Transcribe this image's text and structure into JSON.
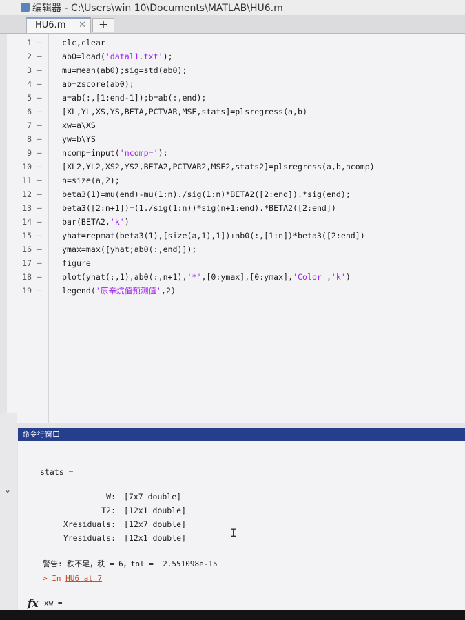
{
  "window": {
    "title": "编辑器 - C:\\Users\\win  10\\Documents\\MATLAB\\HU6.m"
  },
  "tabs": {
    "active": "HU6.m",
    "close": "✕",
    "add": "+"
  },
  "editor": {
    "mark": "–",
    "lines": [
      {
        "n": "1",
        "parts": [
          "clc,clear"
        ]
      },
      {
        "n": "2",
        "parts": [
          "ab0=load(",
          "'datal1.txt'",
          ");"
        ]
      },
      {
        "n": "3",
        "parts": [
          "mu=mean(ab0);sig=std(ab0);"
        ]
      },
      {
        "n": "4",
        "parts": [
          "ab=zscore(ab0);"
        ]
      },
      {
        "n": "5",
        "parts": [
          "a=ab(:,[1:end-1]);b=ab(:,end);"
        ]
      },
      {
        "n": "6",
        "parts": [
          "[XL,YL,XS,YS,BETA,PCTVAR,MSE,stats]=plsregress(a,b)"
        ]
      },
      {
        "n": "7",
        "parts": [
          "xw=a\\XS"
        ]
      },
      {
        "n": "8",
        "parts": [
          "yw=b\\YS"
        ]
      },
      {
        "n": "9",
        "parts": [
          "ncomp=input(",
          "'ncomp='",
          ");"
        ]
      },
      {
        "n": "10",
        "parts": [
          "[XL2,YL2,XS2,YS2,BETA2,PCTVAR2,MSE2,stats2]=plsregress(a,b,ncomp)"
        ]
      },
      {
        "n": "11",
        "parts": [
          "n=size(a,2);"
        ]
      },
      {
        "n": "12",
        "parts": [
          "beta3(1)=mu(end)-mu(1:n)./sig(1:n)*BETA2([2:end]).*sig(end);"
        ]
      },
      {
        "n": "13",
        "parts": [
          "beta3([2:n+1])=(1./sig(1:n))*sig(n+1:end).*BETA2([2:end])"
        ]
      },
      {
        "n": "14",
        "parts": [
          "bar(BETA2,",
          "'k'",
          ")"
        ]
      },
      {
        "n": "15",
        "parts": [
          "yhat=repmat(beta3(1),[size(a,1),1])+ab0(:,[1:n])*beta3([2:end])"
        ]
      },
      {
        "n": "16",
        "parts": [
          "ymax=max([yhat;ab0(:,end)]);"
        ]
      },
      {
        "n": "17",
        "parts": [
          "figure"
        ]
      },
      {
        "n": "18",
        "parts": [
          "plot(yhat(:,1),ab0(:,n+1),",
          "'*'",
          ",[0:ymax],[0:ymax],",
          "'Color'",
          ",",
          "'k'",
          ")"
        ]
      },
      {
        "n": "19",
        "parts": [
          "legend(",
          "'原辛烷值预测值'",
          ",2)"
        ]
      }
    ]
  },
  "command_window": {
    "title": "命令行窗口",
    "stats_label": "stats =",
    "fields": [
      {
        "name": "W:",
        "value": "[7x7 double]"
      },
      {
        "name": "T2:",
        "value": "[12x1 double]"
      },
      {
        "name": "Xresiduals:",
        "value": "[12x7 double]"
      },
      {
        "name": "Yresiduals:",
        "value": "[12x1 double]"
      }
    ],
    "warning": "警告: 秩不足，秩 = 6，tol =  2.551098e-15",
    "warn_prefix": "> In ",
    "warn_link": "HU6 at 7",
    "fx": "fx",
    "prompt": "xw ="
  },
  "colors": {
    "header_bg": "#253f8c",
    "string": "#a020f0",
    "warning": "#d03a1e"
  }
}
